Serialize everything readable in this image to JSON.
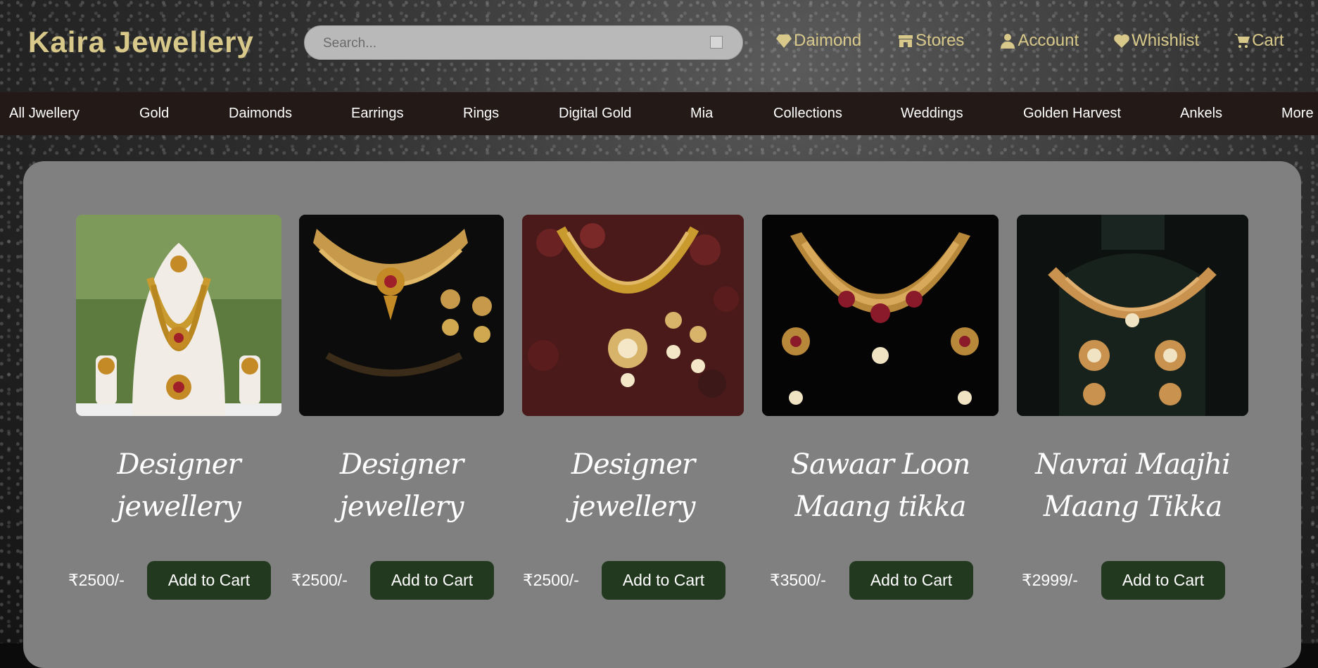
{
  "brand": "Kaira Jewellery",
  "search": {
    "placeholder": "Search..."
  },
  "top_links": [
    {
      "label": "Daimond",
      "icon": "gem-icon"
    },
    {
      "label": "Stores",
      "icon": "store-icon"
    },
    {
      "label": "Account",
      "icon": "user-icon"
    },
    {
      "label": "Whishlist",
      "icon": "heart-icon"
    },
    {
      "label": "Cart",
      "icon": "cart-icon"
    }
  ],
  "nav": [
    "All Jwellery",
    "Gold",
    "Daimonds",
    "Earrings",
    "Rings",
    "Digital Gold",
    "Mia",
    "Collections",
    "Weddings",
    "Golden Harvest",
    "Ankels",
    "More"
  ],
  "products": [
    {
      "title_line1": "Designer",
      "title_line2": "jewellery",
      "price": "₹2500/-",
      "button": "Add to Cart",
      "image": "gold-necklace-set-on-white-bust"
    },
    {
      "title_line1": "Designer",
      "title_line2": "jewellery",
      "price": "₹2500/-",
      "button": "Add to Cart",
      "image": "choker-and-earrings-on-black"
    },
    {
      "title_line1": "Designer",
      "title_line2": "jewellery",
      "price": "₹2500/-",
      "button": "Add to Cart",
      "image": "gold-necklace-on-red-beans"
    },
    {
      "title_line1": "Sawaar Loon",
      "title_line2": "Maang tikka",
      "price": "₹3500/-",
      "button": "Add to Cart",
      "image": "kundan-necklace-on-black"
    },
    {
      "title_line1": "Navrai Maajhi",
      "title_line2": "Maang Tikka",
      "price": "₹2999/-",
      "button": "Add to Cart",
      "image": "necklace-on-dark-bust"
    }
  ],
  "colors": {
    "accent": "#d8c98a",
    "nav_bg": "#231a18",
    "panel": "#808080",
    "button": "#23391f"
  }
}
